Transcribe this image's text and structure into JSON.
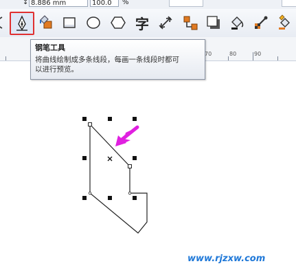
{
  "property_bar": {
    "size_value": "8.886 mm",
    "scale_value": "100.0",
    "percent_label": "%"
  },
  "toolbox": {
    "tools": [
      {
        "name": "pen-tool",
        "icon": "pen-nib-icon",
        "active": true
      },
      {
        "name": "smart-fill-tool",
        "icon": "smart-fill-icon"
      },
      {
        "name": "rectangle-tool",
        "icon": "rectangle-icon"
      },
      {
        "name": "ellipse-tool",
        "icon": "ellipse-icon"
      },
      {
        "name": "polygon-tool",
        "icon": "hexagon-icon"
      },
      {
        "name": "text-tool",
        "icon": "text-icon",
        "glyph": "字"
      },
      {
        "name": "dimension-tool",
        "icon": "dimension-icon"
      },
      {
        "name": "connector-tool",
        "icon": "connector-icon"
      },
      {
        "name": "drop-shadow-tool",
        "icon": "shadow-icon"
      },
      {
        "name": "fill-tool",
        "icon": "paint-bucket-icon"
      },
      {
        "name": "eyedropper-tool",
        "icon": "eyedropper-icon"
      },
      {
        "name": "interactive-fill-tool",
        "icon": "interactive-fill-icon"
      }
    ],
    "active_border_color": "#e03030"
  },
  "ruler": {
    "labels": [
      "70",
      "80",
      "90"
    ]
  },
  "tooltip": {
    "title": "钢笔工具",
    "line1": "将曲线绘制成多条线段，每画一条线段时都可",
    "line2": "以进行预览。"
  },
  "annotation": {
    "arrow_color": "#e020e0"
  },
  "watermark": {
    "text": "www.rjzxw.com",
    "color": "#1f78d8"
  }
}
